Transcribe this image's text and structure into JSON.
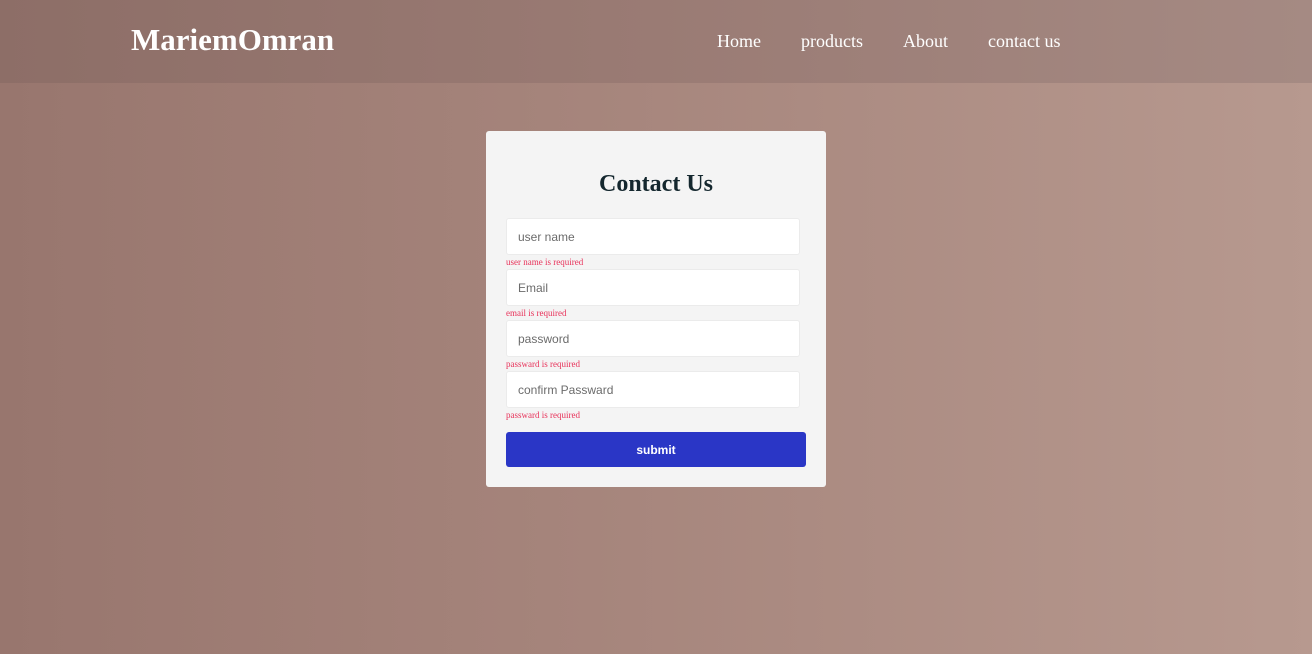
{
  "navbar": {
    "brand": "MariemOmran",
    "links": [
      "Home",
      "products",
      "About",
      "contact us"
    ]
  },
  "form": {
    "title": "Contact Us",
    "fields": [
      {
        "placeholder": "user name",
        "value": "",
        "error": "user name is required"
      },
      {
        "placeholder": "Email",
        "value": "",
        "error": "email is required"
      },
      {
        "placeholder": "password",
        "value": "",
        "error": "passward is required"
      },
      {
        "placeholder": "confirm Passward",
        "value": "",
        "error": "passward is required"
      }
    ],
    "submit_label": "submit"
  },
  "colors": {
    "submit_button": "#2a36c6",
    "error_text": "#e8325a",
    "title_text": "#14272e",
    "card_background": "#f4f4f4"
  }
}
